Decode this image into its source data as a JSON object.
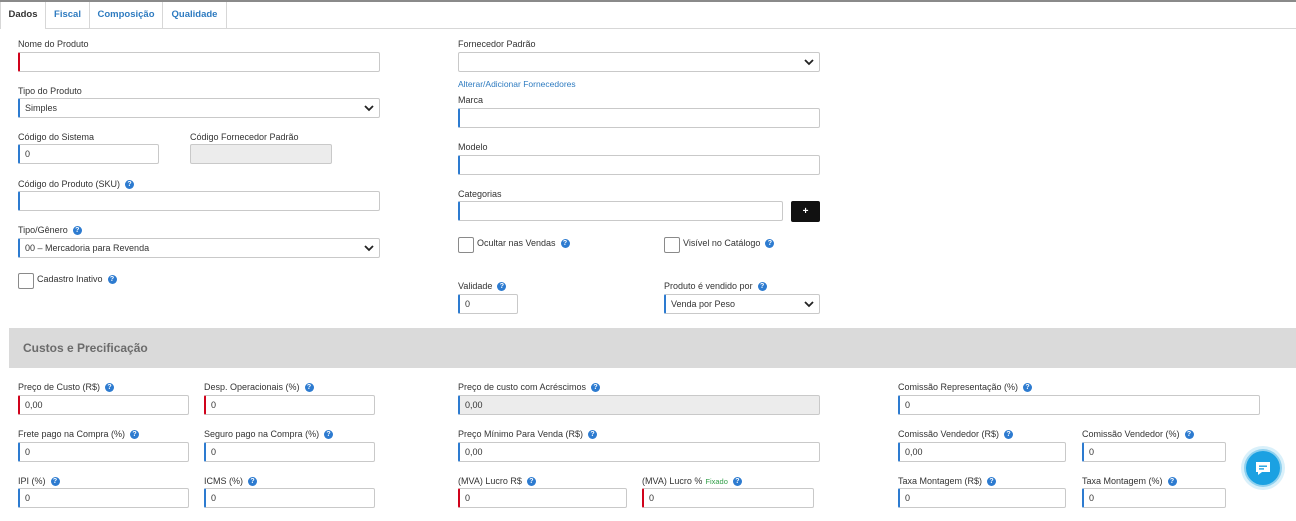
{
  "tabs": [
    "Dados",
    "Fiscal",
    "Composição",
    "Qualidade"
  ],
  "dados": {
    "nome_produto_label": "Nome do Produto",
    "nome_produto_value": "",
    "tipo_produto_label": "Tipo do Produto",
    "tipo_produto_value": "Simples",
    "codigo_sistema_label": "Código do Sistema",
    "codigo_sistema_value": "0",
    "codigo_fornecedor_label": "Código Fornecedor Padrão",
    "codigo_fornecedor_value": "",
    "sku_label": "Código do Produto (SKU)",
    "sku_value": "",
    "tipo_genero_label": "Tipo/Gênero",
    "tipo_genero_value": "00 – Mercadoria para Revenda",
    "cadastro_inativo_label": "Cadastro Inativo",
    "fornecedor_label": "Fornecedor Padrão",
    "fornecedor_value": "",
    "alterar_fornecedores_link": "Alterar/Adicionar Fornecedores",
    "marca_label": "Marca",
    "marca_value": "",
    "modelo_label": "Modelo",
    "modelo_value": "",
    "categorias_label": "Categorias",
    "categorias_value": "",
    "add_categoria_label": "+",
    "ocultar_vendas_label": "Ocultar nas Vendas",
    "visivel_catalogo_label": "Visível no Catálogo",
    "validade_label": "Validade",
    "validade_value": "0",
    "vendido_por_label": "Produto é vendido por",
    "vendido_por_value": "Venda por Peso"
  },
  "custos": {
    "section_title": "Custos e Precificação",
    "preco_custo_label": "Preço de Custo (R$)",
    "preco_custo_value": "0,00",
    "desp_operacionais_label": "Desp. Operacionais (%)",
    "desp_operacionais_value": "0",
    "frete_label": "Frete pago na Compra (%)",
    "frete_value": "0",
    "seguro_label": "Seguro pago na Compra (%)",
    "seguro_value": "0",
    "ipi_label": "IPI (%)",
    "ipi_value": "0",
    "icms_label": "ICMS (%)",
    "icms_value": "0",
    "custo_acrescimos_label": "Preço de custo com Acréscimos",
    "custo_acrescimos_value": "0,00",
    "preco_minimo_label": "Preço Mínimo Para Venda (R$)",
    "preco_minimo_value": "0,00",
    "mva_lucro_rs_label": "(MVA) Lucro R$",
    "mva_lucro_rs_value": "0",
    "mva_lucro_pct_label": "(MVA) Lucro %",
    "mva_fixado_label": "Fixado",
    "mva_lucro_pct_value": "0",
    "comissao_repr_label": "Comissão Representação (%)",
    "comissao_repr_value": "0",
    "comissao_vend_rs_label": "Comissão Vendedor (R$)",
    "comissao_vend_rs_value": "0,00",
    "comissao_vend_pct_label": "Comissão Vendedor (%)",
    "comissao_vend_pct_value": "0",
    "taxa_montagem_rs_label": "Taxa Montagem (R$)",
    "taxa_montagem_rs_value": "0",
    "taxa_montagem_pct_label": "Taxa Montagem (%)",
    "taxa_montagem_pct_value": "0"
  },
  "icons": {
    "help": "question-circle-icon",
    "chat": "chat-bubble-icon",
    "select": "chevron-down-icon"
  },
  "colors": {
    "accent": "#2d7bd0",
    "required": "#d0021b",
    "tab_link": "#2e7bc0",
    "section_band": "#dadada",
    "chat": "#1ba1e2",
    "fixado": "#33a04a"
  }
}
